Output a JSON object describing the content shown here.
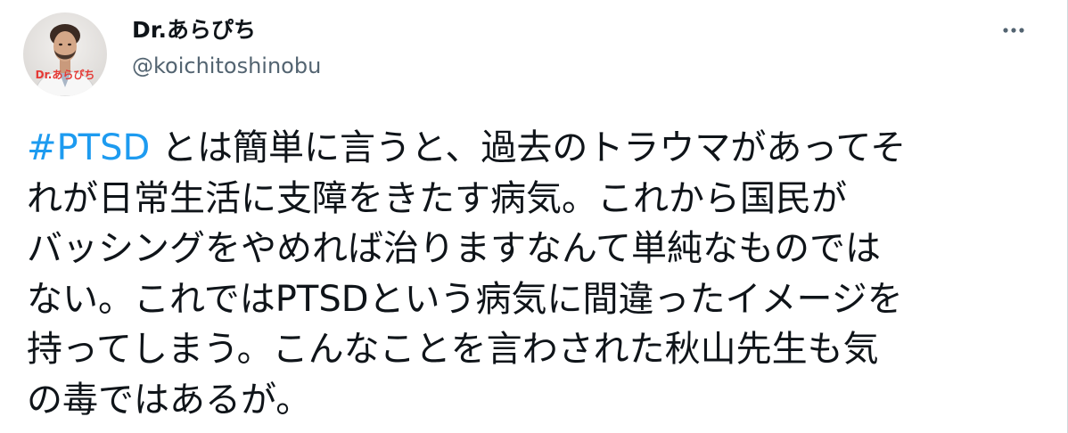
{
  "tweet": {
    "author": {
      "display_name": "Dr.あらぴち",
      "handle": "@koichitoshinobu",
      "avatar_overlay_text": "Dr.あらぴち"
    },
    "more_icon": "more-horizontal-icon",
    "hashtag": "#PTSD",
    "text_lines": [
      " とは簡単に言うと、過去のトラウマがあってそ",
      "れが日常生活に支障をきたす病気。これから国民が",
      "バッシングをやめれば治りますなんて単純なものでは",
      "ない。これではPTSDという病気に間違ったイメージを",
      "持ってしまう。こんなことを言わされた秋山先生も気",
      "の毒ではあるが。"
    ],
    "colors": {
      "text": "#0f1419",
      "secondary": "#536471",
      "link": "#1d9bf0"
    }
  }
}
